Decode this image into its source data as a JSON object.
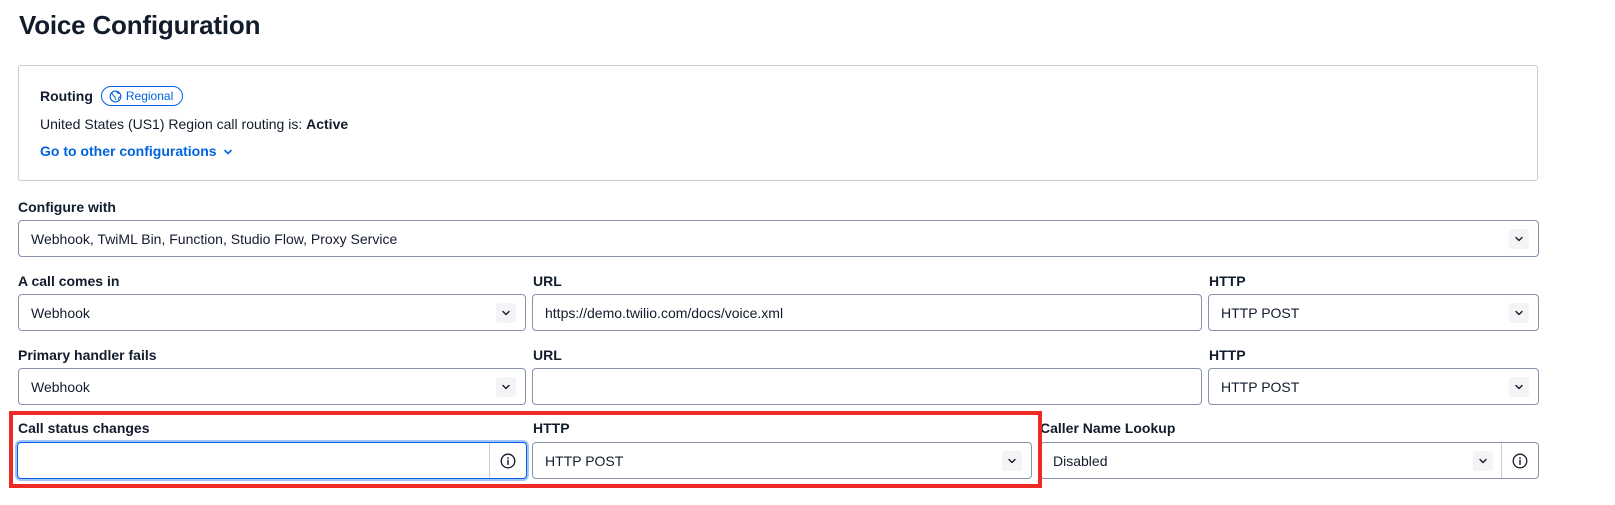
{
  "page": {
    "title": "Voice Configuration"
  },
  "routing": {
    "label": "Routing",
    "badge": "Regional",
    "status_prefix": "United States (US1) Region call routing is:",
    "status_value": "Active",
    "other_configs_link": "Go to other configurations"
  },
  "configure_with": {
    "label": "Configure with",
    "value": "Webhook, TwiML Bin, Function, Studio Flow, Proxy Service"
  },
  "call_comes_in": {
    "label": "A call comes in",
    "type_value": "Webhook",
    "url_label": "URL",
    "url_value": "https://demo.twilio.com/docs/voice.xml",
    "http_label": "HTTP",
    "http_value": "HTTP POST"
  },
  "primary_handler_fails": {
    "label": "Primary handler fails",
    "type_value": "Webhook",
    "url_label": "URL",
    "url_value": "",
    "http_label": "HTTP",
    "http_value": "HTTP POST"
  },
  "call_status_changes": {
    "label": "Call status changes",
    "url_value": "",
    "http_label": "HTTP",
    "http_value": "HTTP POST"
  },
  "caller_name_lookup": {
    "label": "Caller Name Lookup",
    "value": "Disabled"
  },
  "colors": {
    "link": "#0263e0",
    "border": "#8891aa",
    "highlight": "#ee2a24",
    "focus": "#0263e0"
  },
  "icons": {
    "badge": "globe-icon",
    "link": "chevron-down-icon",
    "select": "chevron-down-icon",
    "info": "info-icon"
  }
}
